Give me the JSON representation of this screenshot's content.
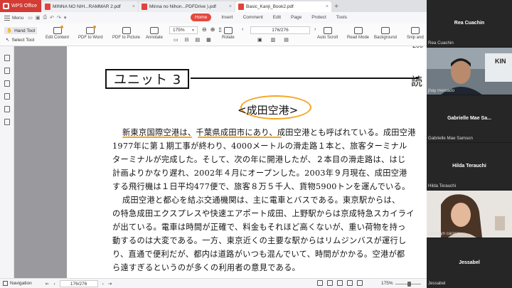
{
  "app": {
    "name": "WPS Office",
    "tabs": [
      {
        "label": "MINNA NO NIH...RAMMAR 2.pdf",
        "active": false
      },
      {
        "label": "Minna no Nihon...PDFDrive ).pdf",
        "active": false
      },
      {
        "label": "Basic_Kanji_Book2.pdf",
        "active": true
      }
    ],
    "new_tab": "+",
    "close": "×"
  },
  "menu": {
    "menu_label": "Menu",
    "tabs": [
      "Home",
      "Insert",
      "Comment",
      "Edit",
      "Page",
      "Protect",
      "Tools"
    ],
    "active_tab": "Home"
  },
  "toolbar": {
    "hand_tool": "Hand Tool",
    "select_tool": "Select Tool",
    "edit_content": "Edit Content",
    "pdf_to_word": "PDF to Word",
    "pdf_to_picture": "PDF to Picture",
    "annotate": "Annotate",
    "zoom": "175%",
    "rotate": "Rotate",
    "page_indicator": "176/276",
    "auto_scroll": "Auto Scroll",
    "read_mode": "Read Mode",
    "background": "Background",
    "snip": "Snip and"
  },
  "document": {
    "unit_title": "ユニット 3",
    "right_edge": "読",
    "top_edge": "200",
    "section_title": "<成田空港>",
    "lines": [
      "新東京国際空港は、千葉県成田市にあり、成田空港とも呼ばれている。成田空港",
      "1977年に第１期工事が終わり、4000メートルの滑走路１本と、旅客ターミナル",
      "ターミナルが完成した。そして、次の年に開港したが、２本目の滑走路は、はじ",
      "計画よりかなり遅れ、2002年４月にオープンした。2003年９月現在、成田空港",
      "する飛行機は１日平均477便で、旅客８万５千人、貨物5900トンを運んでいる。",
      "成田空港と都心を結ぶ交通機関は、主に電車とバスである。東京駅からは、",
      "の特急成田エクスプレスや快速エアポート成田、上野駅からは京成特急スカイライ",
      "が出ている。電車は時間が正確で、料金もそれほど高くないが、重い荷物を持っ",
      "動するのは大変である。一方、東京近くの主要な駅からはリムジンバスが運行し",
      "り、直通で便利だが、都内は道路がいつも混んでいて、時間がかかる。空港が都",
      "ら遠すぎるというのが多くの利用者の意見である。"
    ]
  },
  "statusbar": {
    "navigation": "Navigation",
    "page": "176/276",
    "zoom": "175%"
  },
  "participants": [
    {
      "tile_title": "Rea Cuachin",
      "name": "Rea Cuachin"
    },
    {
      "tile_title": "",
      "name": "jhay mercado",
      "overlay": "KIN"
    },
    {
      "tile_title": "Gabrielle Mae Sa...",
      "name": "Gabrielle Mae Samson"
    },
    {
      "tile_title": "Hilda Terauchi",
      "name": "Hilda Terauchi"
    },
    {
      "tile_title": "",
      "name": "caseylyn carane"
    },
    {
      "tile_title": "Jessabel",
      "name": "Jessabel"
    }
  ],
  "colors": {
    "wps_red": "#d33b34",
    "annotation_orange": "#f5a623"
  }
}
